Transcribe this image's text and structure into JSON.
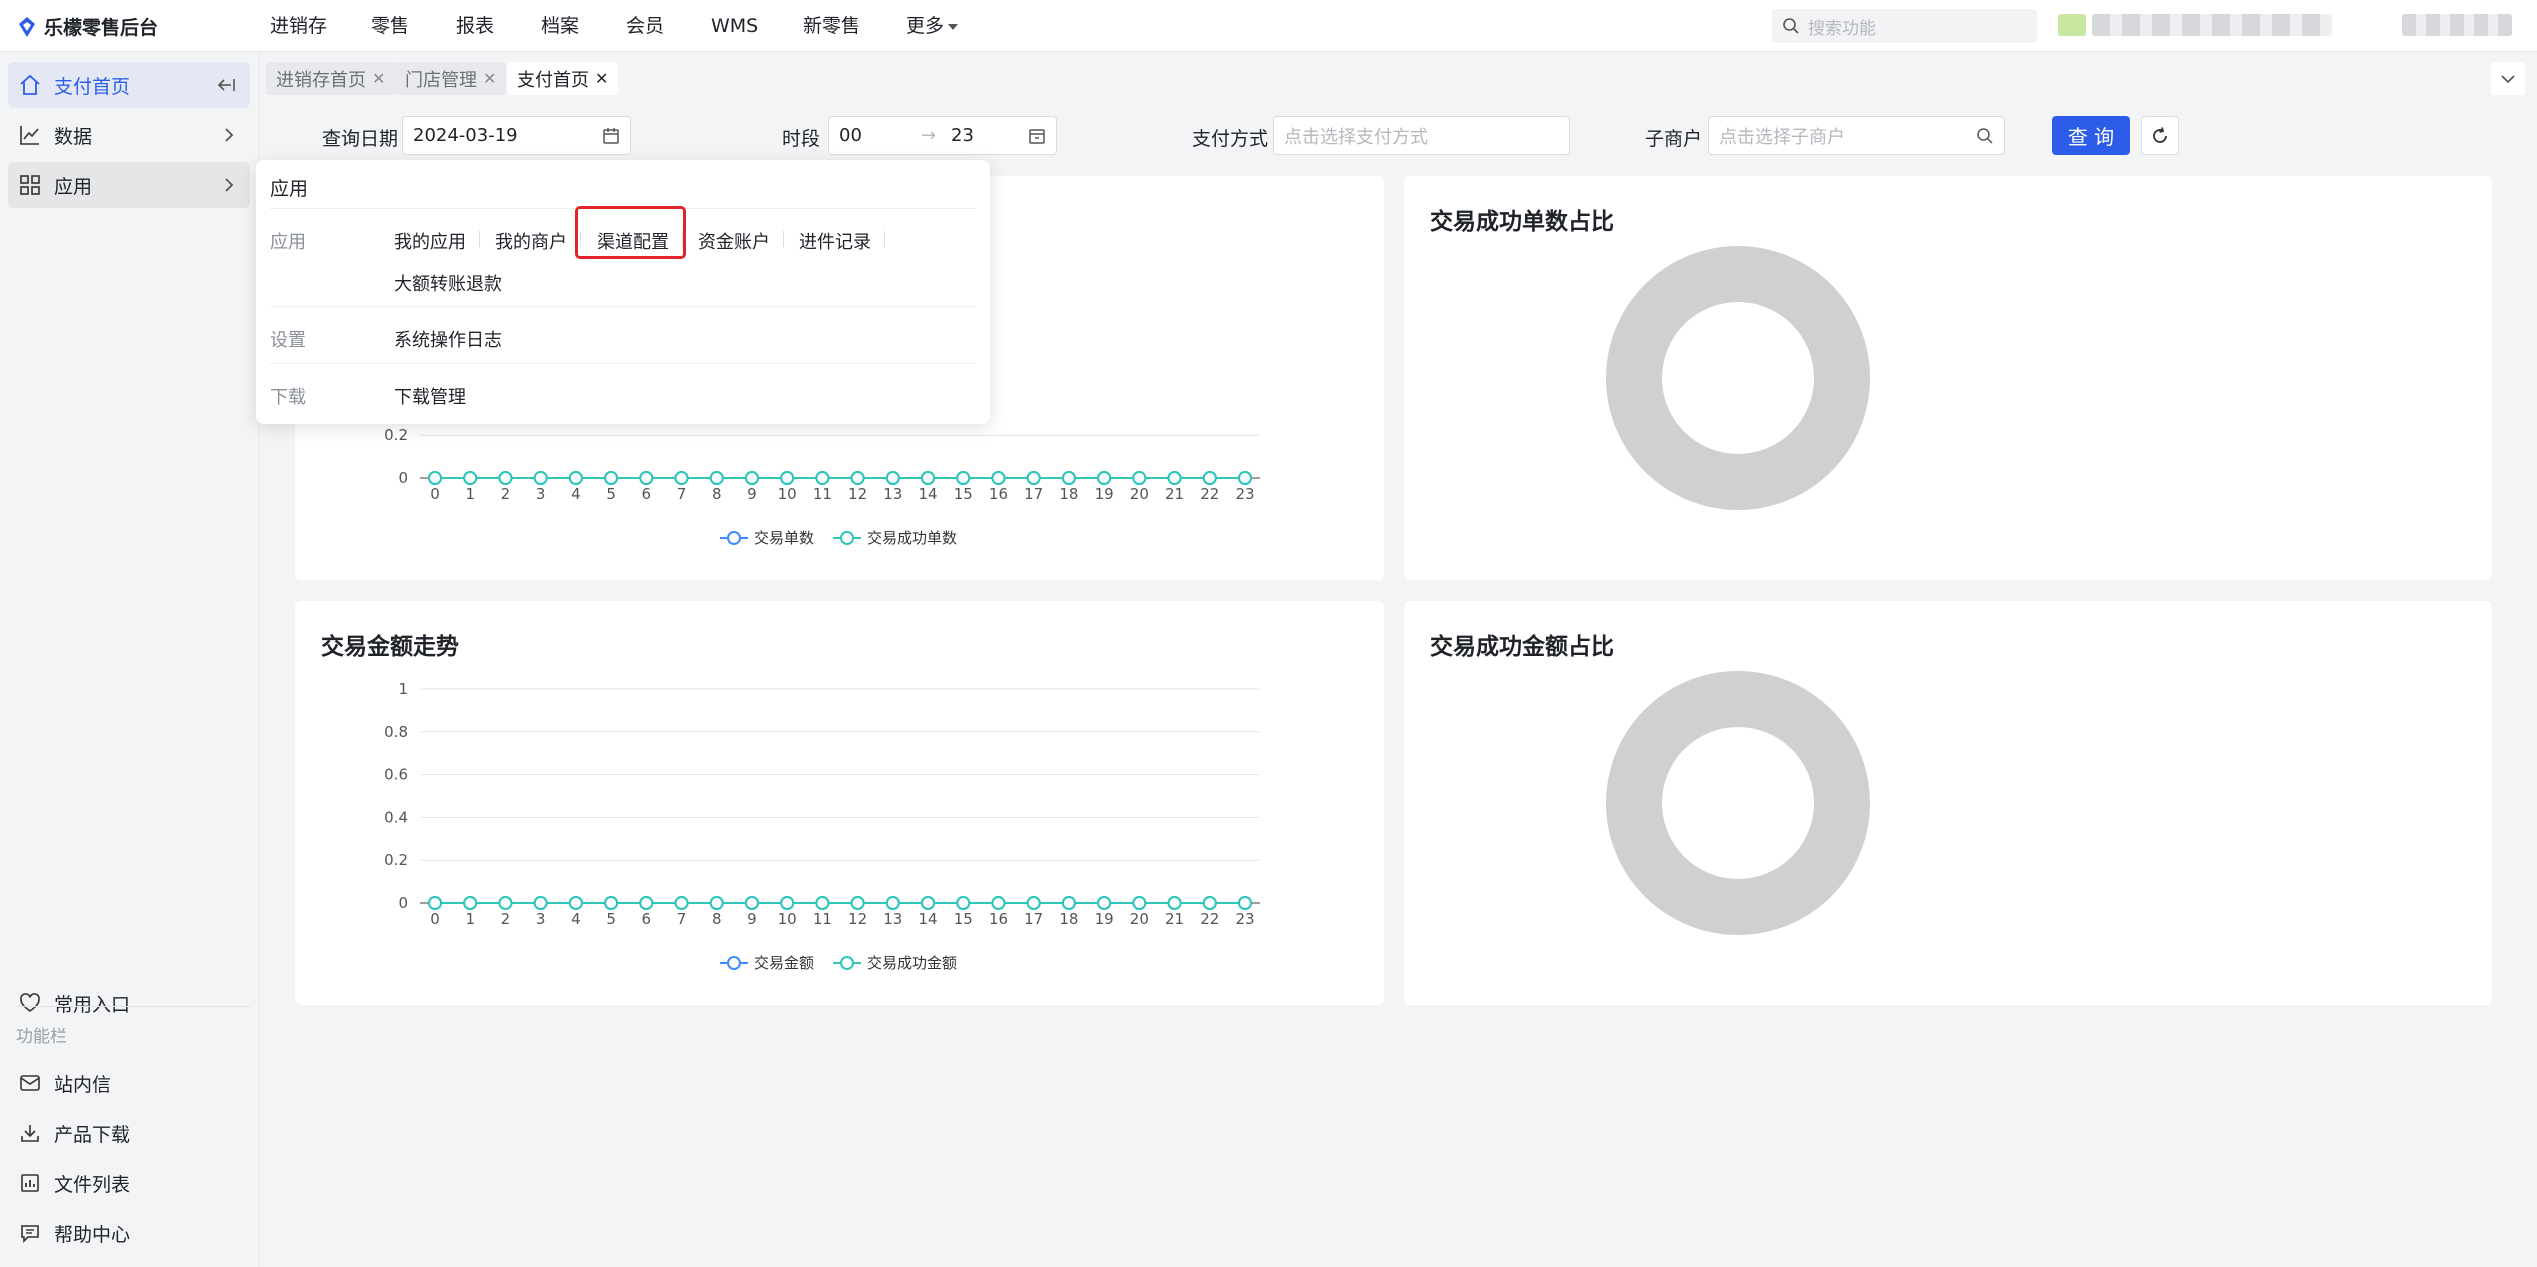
{
  "app": {
    "title": "乐檬零售后台"
  },
  "top_menu": [
    "进销存",
    "零售",
    "报表",
    "档案",
    "会员",
    "WMS",
    "新零售",
    "更多"
  ],
  "top_search": {
    "placeholder": "搜索功能"
  },
  "sidebar": {
    "items": [
      {
        "label": "支付首页",
        "icon": "home-icon"
      },
      {
        "label": "数据",
        "icon": "chart-line-icon"
      },
      {
        "label": "应用",
        "icon": "grid-icon"
      }
    ],
    "bottom": {
      "favorites": "常用入口",
      "section": "功能栏",
      "items": [
        {
          "label": "站内信",
          "icon": "mail-icon"
        },
        {
          "label": "产品下载",
          "icon": "download-icon"
        },
        {
          "label": "文件列表",
          "icon": "file-list-icon"
        },
        {
          "label": "帮助中心",
          "icon": "help-icon"
        }
      ]
    }
  },
  "tabs": [
    {
      "label": "进销存首页"
    },
    {
      "label": "门店管理"
    },
    {
      "label": "支付首页"
    }
  ],
  "filters": {
    "date_label": "查询日期",
    "date_value": "2024-03-19",
    "period_label": "时段",
    "period_start": "00",
    "period_arrow": "→",
    "period_end": "23",
    "pay_label": "支付方式",
    "pay_placeholder": "点击选择支付方式",
    "sub_label": "子商户",
    "sub_placeholder": "点击选择子商户",
    "query_button": "查 询"
  },
  "cards": {
    "count_ratio_title": "交易成功单数占比",
    "amount_trend_title": "交易金额走势",
    "amount_ratio_title": "交易成功金额占比"
  },
  "popover": {
    "title": "应用",
    "groups": [
      {
        "category": "应用",
        "links": [
          "我的应用",
          "我的商户",
          "渠道配置",
          "资金账户",
          "进件记录",
          "大额转账退款"
        ]
      },
      {
        "category": "设置",
        "links": [
          "系统操作日志"
        ]
      },
      {
        "category": "下载",
        "links": [
          "下载管理"
        ]
      }
    ]
  },
  "colors": {
    "primary": "#2d5de8",
    "series_blue": "#3d8bff",
    "series_teal": "#2ec7b8",
    "donut": "#d0d0d0",
    "highlight": "#e0242a"
  },
  "chart_data": [
    {
      "type": "line",
      "partially_hidden": true,
      "x": [
        "0",
        "1",
        "2",
        "3",
        "4",
        "5",
        "6",
        "7",
        "8",
        "9",
        "10",
        "11",
        "12",
        "13",
        "14",
        "15",
        "16",
        "17",
        "18",
        "19",
        "20",
        "21",
        "22",
        "23"
      ],
      "series": [
        {
          "name": "交易单数",
          "values": [
            0,
            0,
            0,
            0,
            0,
            0,
            0,
            0,
            0,
            0,
            0,
            0,
            0,
            0,
            0,
            0,
            0,
            0,
            0,
            0,
            0,
            0,
            0,
            0
          ]
        },
        {
          "name": "交易成功单数",
          "values": [
            0,
            0,
            0,
            0,
            0,
            0,
            0,
            0,
            0,
            0,
            0,
            0,
            0,
            0,
            0,
            0,
            0,
            0,
            0,
            0,
            0,
            0,
            0,
            0
          ]
        }
      ],
      "y_ticks": [
        "0",
        "0.2"
      ]
    },
    {
      "type": "pie",
      "title": "交易成功单数占比",
      "values": []
    },
    {
      "type": "line",
      "title": "交易金额走势",
      "x": [
        "0",
        "1",
        "2",
        "3",
        "4",
        "5",
        "6",
        "7",
        "8",
        "9",
        "10",
        "11",
        "12",
        "13",
        "14",
        "15",
        "16",
        "17",
        "18",
        "19",
        "20",
        "21",
        "22",
        "23"
      ],
      "series": [
        {
          "name": "交易金额",
          "values": [
            0,
            0,
            0,
            0,
            0,
            0,
            0,
            0,
            0,
            0,
            0,
            0,
            0,
            0,
            0,
            0,
            0,
            0,
            0,
            0,
            0,
            0,
            0,
            0
          ]
        },
        {
          "name": "交易成功金额",
          "values": [
            0,
            0,
            0,
            0,
            0,
            0,
            0,
            0,
            0,
            0,
            0,
            0,
            0,
            0,
            0,
            0,
            0,
            0,
            0,
            0,
            0,
            0,
            0,
            0
          ]
        }
      ],
      "ylim": [
        0,
        1
      ],
      "y_ticks": [
        "0",
        "0.2",
        "0.4",
        "0.6",
        "0.8",
        "1"
      ]
    },
    {
      "type": "pie",
      "title": "交易成功金额占比",
      "values": []
    }
  ]
}
